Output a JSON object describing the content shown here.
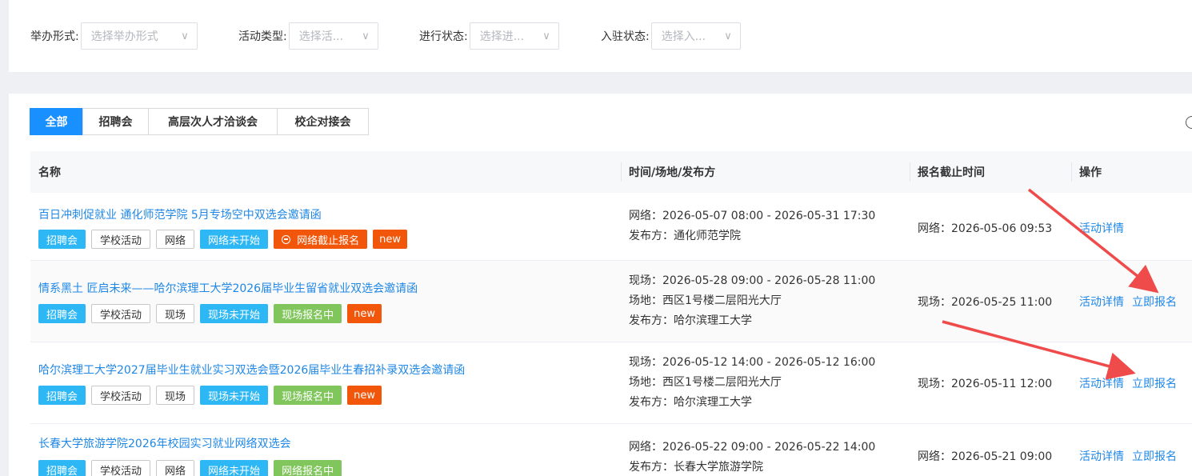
{
  "filters": [
    {
      "label": "举办形式:",
      "placeholder": "选择举办形式"
    },
    {
      "label": "活动类型:",
      "placeholder": "选择活..."
    },
    {
      "label": "进行状态:",
      "placeholder": "选择进..."
    },
    {
      "label": "入驻状态:",
      "placeholder": "选择入..."
    }
  ],
  "tabs": [
    "全部",
    "招聘会",
    "高层次人才洽谈会",
    "校企对接会"
  ],
  "active_tab": "全部",
  "columns": [
    "名称",
    "时间/场地/发布方",
    "报名截止时间",
    "操作"
  ],
  "rows": [
    {
      "title": "百日冲刺促就业 通化师范学院 5月专场空中双选会邀请函",
      "tags": [
        {
          "text": "招聘会",
          "style": "blue"
        },
        {
          "text": "学校活动",
          "style": "plain"
        },
        {
          "text": "网络",
          "style": "plain"
        },
        {
          "text": "网络未开始",
          "style": "blue"
        },
        {
          "text": "网络截止报名",
          "style": "red",
          "icon": "minus-circle-icon"
        },
        {
          "text": "new",
          "style": "orange"
        }
      ],
      "info": [
        "网络：2026-05-07 08:00 - 2026-05-31 17:30",
        "发布方：通化师范学院"
      ],
      "deadline": "网络：2026-05-06 09:53",
      "ops": [
        "活动详情"
      ]
    },
    {
      "title": "情系黑土 匠启未来——哈尔滨理工大学2026届毕业生留省就业双选会邀请函",
      "tags": [
        {
          "text": "招聘会",
          "style": "blue"
        },
        {
          "text": "学校活动",
          "style": "plain"
        },
        {
          "text": "现场",
          "style": "plain"
        },
        {
          "text": "现场未开始",
          "style": "blue"
        },
        {
          "text": "现场报名中",
          "style": "green"
        },
        {
          "text": "new",
          "style": "orange"
        }
      ],
      "info": [
        "现场：2026-05-28 09:00 - 2026-05-28 11:00",
        "场地：西区1号楼二层阳光大厅",
        "发布方：哈尔滨理工大学"
      ],
      "deadline": "现场：2026-05-25 11:00",
      "ops": [
        "活动详情",
        "立即报名"
      ]
    },
    {
      "title": "哈尔滨理工大学2027届毕业生就业实习双选会暨2026届毕业生春招补录双选会邀请函",
      "tags": [
        {
          "text": "招聘会",
          "style": "blue"
        },
        {
          "text": "学校活动",
          "style": "plain"
        },
        {
          "text": "现场",
          "style": "plain"
        },
        {
          "text": "现场未开始",
          "style": "blue"
        },
        {
          "text": "现场报名中",
          "style": "green"
        },
        {
          "text": "new",
          "style": "orange"
        }
      ],
      "info": [
        "现场：2026-05-12 14:00 - 2026-05-12 16:00",
        "场地：西区1号楼二层阳光大厅",
        "发布方：哈尔滨理工大学"
      ],
      "deadline": "现场：2026-05-11 12:00",
      "ops": [
        "活动详情",
        "立即报名"
      ]
    },
    {
      "title": "长春大学旅游学院2026年校园实习就业网络双选会",
      "tags": [
        {
          "text": "招聘会",
          "style": "blue"
        },
        {
          "text": "学校活动",
          "style": "plain"
        },
        {
          "text": "网络",
          "style": "plain"
        },
        {
          "text": "网络未开始",
          "style": "blue"
        },
        {
          "text": "网络报名中",
          "style": "green"
        }
      ],
      "info": [
        "网络：2026-05-22 09:00 - 2026-05-22 14:00",
        "发布方：长春大学旅游学院"
      ],
      "deadline": "网络：2026-05-21 09:00",
      "ops": [
        "活动详情",
        "立即报名"
      ]
    }
  ],
  "colors": {
    "accent": "#1890ff",
    "link": "#1f87e6",
    "tag_blue": "#2db7f5",
    "tag_green": "#81c65c",
    "tag_orange": "#f2560a",
    "annotation_arrow": "#ef4b4b"
  }
}
